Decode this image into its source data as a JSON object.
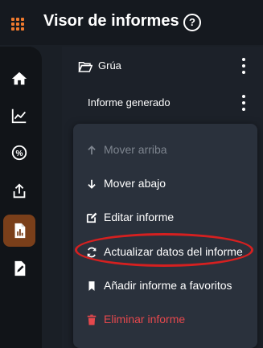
{
  "header": {
    "title": "Visor de informes",
    "help_glyph": "?"
  },
  "sidebar": {
    "items": [
      {
        "icon": "home-icon"
      },
      {
        "icon": "chart-line-icon"
      },
      {
        "icon": "percent-icon"
      },
      {
        "icon": "share-icon"
      },
      {
        "icon": "report-icon",
        "active": true
      },
      {
        "icon": "edit-document-icon"
      }
    ]
  },
  "list": {
    "folder_label": "Grúa",
    "report_label": "Informe generado"
  },
  "menu": {
    "items": [
      {
        "label": "Mover arriba",
        "icon": "arrow-up-icon",
        "disabled": true
      },
      {
        "label": "Mover abajo",
        "icon": "arrow-down-icon"
      },
      {
        "label": "Editar informe",
        "icon": "edit-icon"
      },
      {
        "label": "Actualizar datos del informe",
        "icon": "refresh-icon",
        "highlighted": true
      },
      {
        "label": "Añadir informe a favoritos",
        "icon": "bookmark-icon"
      },
      {
        "label": "Eliminar informe",
        "icon": "trash-icon",
        "danger": true
      }
    ]
  },
  "colors": {
    "accent": "#ef7a2e",
    "active_bg": "#7a3f1a",
    "danger": "#e5484d",
    "highlight_ring": "#d52020"
  }
}
